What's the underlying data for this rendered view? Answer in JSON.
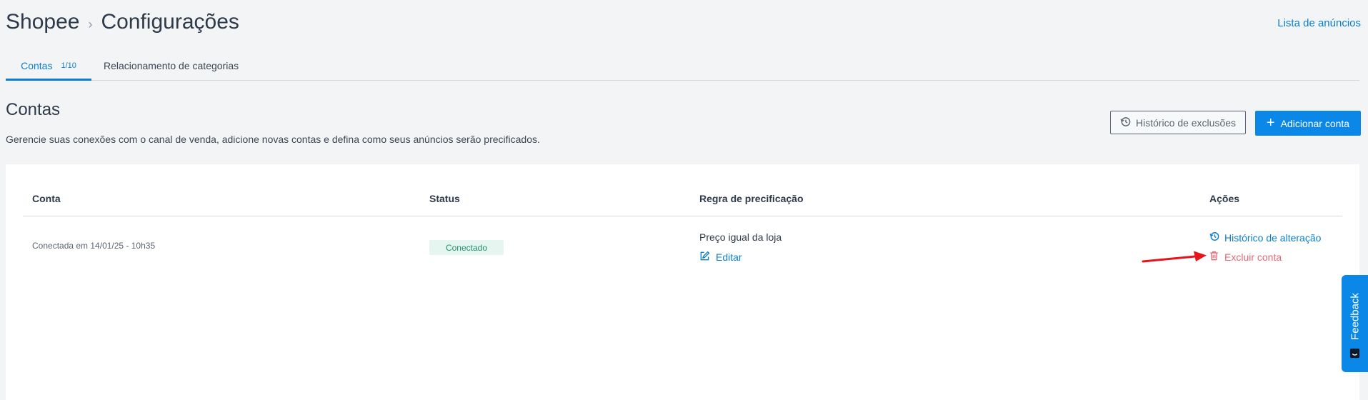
{
  "header": {
    "app": "Shopee",
    "page": "Configurações",
    "separator": "›",
    "link": "Lista de anúncios"
  },
  "tabs": [
    {
      "label": "Contas",
      "count": "1/10",
      "active": true
    },
    {
      "label": "Relacionamento de categorias",
      "active": false
    }
  ],
  "section": {
    "title": "Contas",
    "description": "Gerencie suas conexões com o canal de venda, adicione novas contas e defina como seus anúncios serão precificados.",
    "history_button": "Histórico de exclusões",
    "add_button": "Adicionar conta"
  },
  "table": {
    "columns": [
      "Conta",
      "Status",
      "Regra de precificação",
      "Ações"
    ],
    "rows": [
      {
        "conta": "Conectada em 14/01/25 - 10h35",
        "status": "Conectado",
        "regra": "Preço igual da loja",
        "edit": "Editar",
        "actions": [
          "Histórico de alteração",
          "Excluir conta"
        ]
      }
    ]
  },
  "feedback": {
    "label": "Feedback"
  },
  "colors": {
    "accent": "#0b87e8",
    "link": "#0b7fd1",
    "danger": "#e26a76",
    "success_bg": "#e5f6f1",
    "success_text": "#1f8f6e",
    "annotation_arrow": "#e8141b"
  },
  "icons": [
    "history-icon",
    "plus-icon",
    "edit-icon",
    "trash-icon",
    "feedback-icon"
  ]
}
